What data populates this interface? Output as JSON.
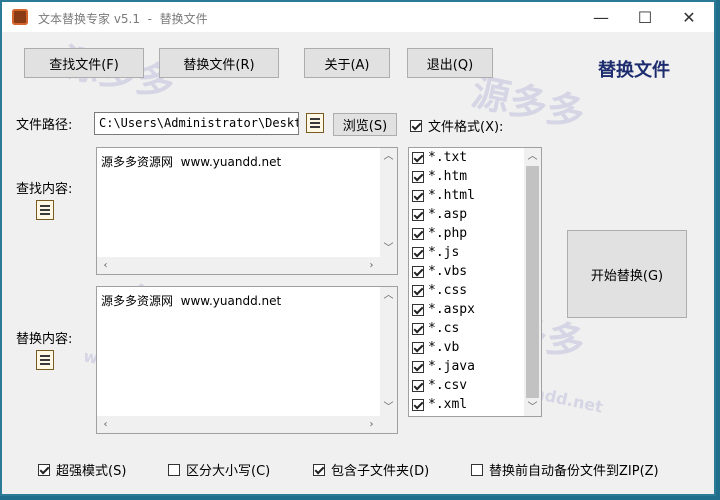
{
  "window": {
    "title": "文本替换专家 v5.1  -  替换文件"
  },
  "titlebar": {
    "minimize": "—",
    "maximize": "☐",
    "close": "✕"
  },
  "toolbar": {
    "find_file": "查找文件(F)",
    "replace_file": "替换文件(R)",
    "about": "关于(A)",
    "exit": "退出(Q)"
  },
  "heading": "替换文件",
  "path": {
    "label": "文件路径:",
    "value": "C:\\Users\\Administrator\\Desktop",
    "browse": "浏览(S)"
  },
  "find": {
    "label": "查找内容:",
    "text": "源多多资源网  www.yuandd.net"
  },
  "replace": {
    "label": "替换内容:",
    "text": "源多多资源网  www.yuandd.net"
  },
  "formats": {
    "label": "文件格式(X):",
    "checked": true,
    "items": [
      "*.txt",
      "*.htm",
      "*.html",
      "*.asp",
      "*.php",
      "*.js",
      "*.vbs",
      "*.css",
      "*.aspx",
      "*.cs",
      "*.vb",
      "*.java",
      "*.csv",
      "*.xml"
    ]
  },
  "start_button": "开始替换(G)",
  "options": {
    "super_mode": {
      "label": "超强模式(S)",
      "checked": true
    },
    "case_sensitive": {
      "label": "区分大小写(C)",
      "checked": false
    },
    "include_subfolders": {
      "label": "包含子文件夹(D)",
      "checked": true
    },
    "backup_zip": {
      "label": "替换前自动备份文件到ZIP(Z)",
      "checked": false
    }
  },
  "watermark": {
    "text": "源多多",
    "url": "www.yuandd.net",
    "brand": "YuanDD.Net"
  }
}
